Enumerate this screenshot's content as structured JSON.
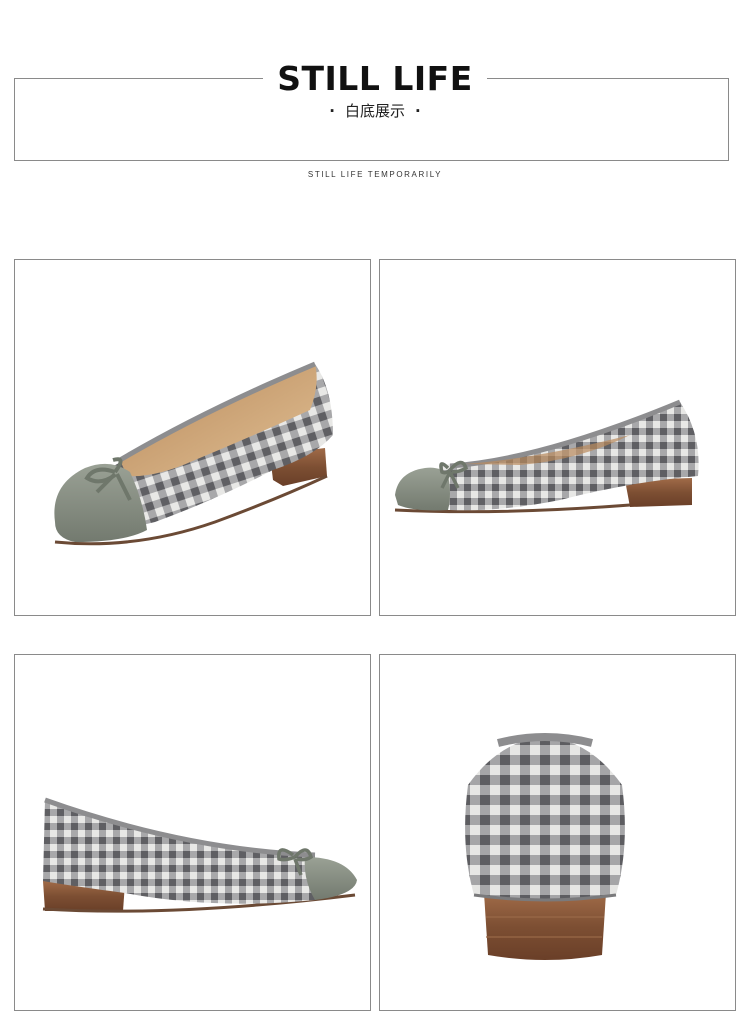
{
  "header": {
    "title": "STILL LIFE",
    "subtitle": "白底展示",
    "caption": "STILL LIFE TEMPORARILY"
  },
  "colors": {
    "frame": "#8a8a8a",
    "gingham_dark": "#6f6f72",
    "gingham_light": "#e8e8e6",
    "toe_leather": "#8a9184",
    "heel_wood": "#8b5a3c",
    "lining": "#c89a6a"
  },
  "gallery": {
    "photos": [
      {
        "name": "shoe-three-quarter-view"
      },
      {
        "name": "shoe-side-view-left"
      },
      {
        "name": "shoe-side-view-right"
      },
      {
        "name": "shoe-back-view"
      }
    ]
  }
}
